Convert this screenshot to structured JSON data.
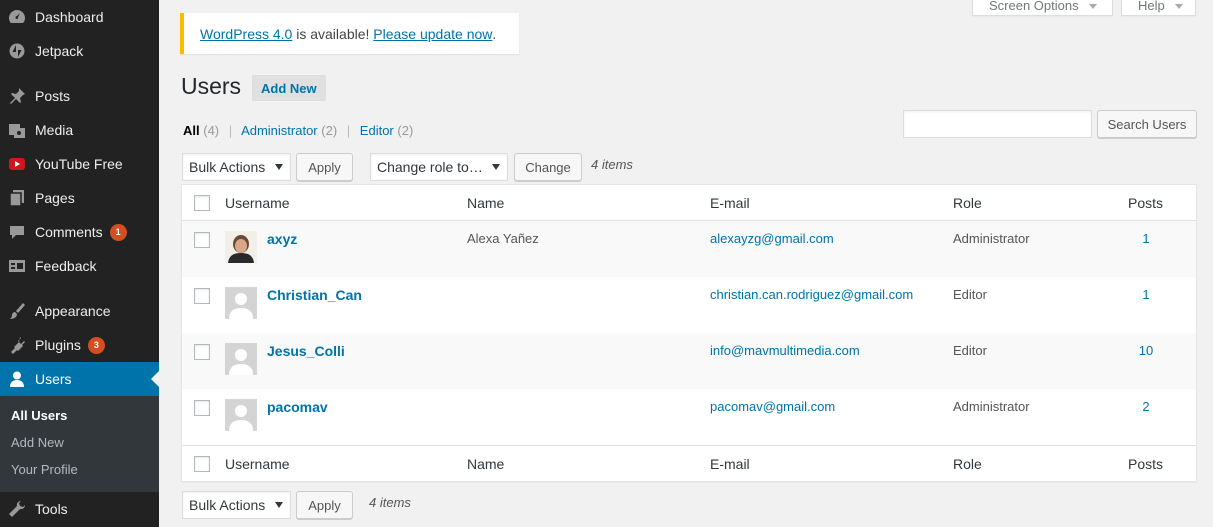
{
  "sidebar": {
    "items": [
      {
        "label": "Dashboard",
        "icon": "dashboard-icon"
      },
      {
        "label": "Jetpack",
        "icon": "jetpack-icon"
      },
      {
        "label": "Posts",
        "icon": "pin-icon"
      },
      {
        "label": "Media",
        "icon": "media-icon"
      },
      {
        "label": "YouTube Free",
        "icon": "youtube-icon"
      },
      {
        "label": "Pages",
        "icon": "pages-icon"
      },
      {
        "label": "Comments",
        "icon": "comment-icon",
        "badge": "1"
      },
      {
        "label": "Feedback",
        "icon": "feedback-icon"
      },
      {
        "label": "Appearance",
        "icon": "brush-icon"
      },
      {
        "label": "Plugins",
        "icon": "plugin-icon",
        "badge": "3"
      },
      {
        "label": "Users",
        "icon": "user-icon",
        "current": true
      },
      {
        "label": "Tools",
        "icon": "wrench-icon"
      }
    ],
    "submenu": [
      "All Users",
      "Add New",
      "Your Profile"
    ]
  },
  "top_tabs": {
    "screen_options": "Screen Options",
    "help": "Help"
  },
  "notice": {
    "link1": "WordPress 4.0",
    "text": " is available! ",
    "link2": "Please update now",
    "end": "."
  },
  "page": {
    "title": "Users",
    "add_new": "Add New"
  },
  "filters": {
    "all": "All",
    "all_count": "(4)",
    "admin": "Administrator",
    "admin_count": "(2)",
    "editor": "Editor",
    "editor_count": "(2)"
  },
  "search": {
    "button": "Search Users",
    "value": ""
  },
  "tablenav": {
    "bulk_actions": "Bulk Actions",
    "apply": "Apply",
    "change_role": "Change role to…",
    "change": "Change",
    "items": "4 items"
  },
  "table": {
    "columns": {
      "username": "Username",
      "name": "Name",
      "email": "E-mail",
      "role": "Role",
      "posts": "Posts"
    },
    "rows": [
      {
        "username": "axyz",
        "name": "Alexa Yañez",
        "email": "alexayzg@gmail.com",
        "role": "Administrator",
        "posts": "1",
        "custom_avatar": true
      },
      {
        "username": "Christian_Can",
        "name": "",
        "email": "christian.can.rodriguez@gmail.com",
        "role": "Editor",
        "posts": "1"
      },
      {
        "username": "Jesus_Colli",
        "name": "",
        "email": "info@mavmultimedia.com",
        "role": "Editor",
        "posts": "10"
      },
      {
        "username": "pacomav",
        "name": "",
        "email": "pacomav@gmail.com",
        "role": "Administrator",
        "posts": "2"
      }
    ]
  },
  "colors": {
    "sidebar_bg": "#222222",
    "accent": "#0073aa",
    "badge": "#d54e21",
    "notice_border": "#ffba00"
  }
}
